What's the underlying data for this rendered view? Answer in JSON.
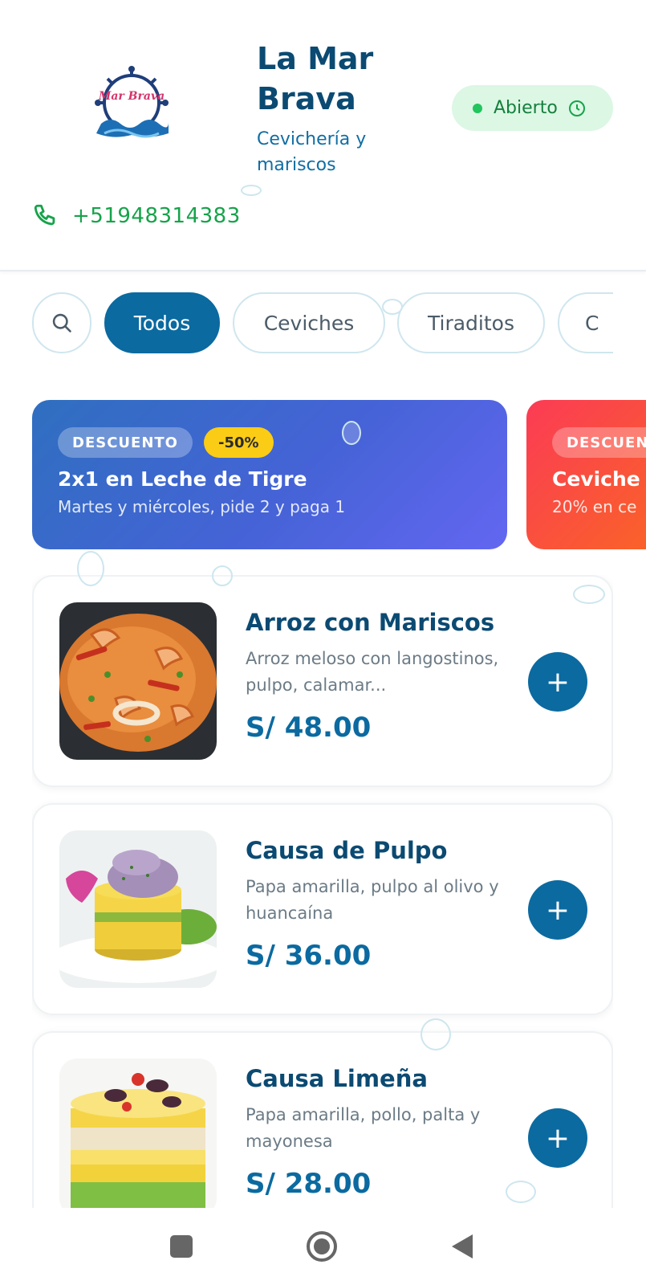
{
  "header": {
    "title": "La Mar Brava",
    "subtitle": "Cevichería y mariscos",
    "logo_text": "Mar Brava",
    "status": {
      "label": "Abierto",
      "color": "#22c55e"
    },
    "phone": "+51948314383"
  },
  "filters": {
    "search_icon": "search-icon",
    "categories": [
      "Todos",
      "Ceviches",
      "Tiraditos",
      "C"
    ],
    "active": "Todos"
  },
  "promos": [
    {
      "tag": "DESCUENTO",
      "badge": "-50%",
      "title": "2x1 en Leche de Tigre",
      "description": "Martes y miércoles, pide 2 y paga 1"
    },
    {
      "tag": "DESCUEN",
      "title": "Ceviche",
      "description": "20% en ce"
    }
  ],
  "dishes": [
    {
      "name": "Arroz con Mariscos",
      "description": "Arroz meloso con langostinos, pulpo, calamar...",
      "price": "S/ 48.00"
    },
    {
      "name": "Causa de Pulpo",
      "description": "Papa amarilla, pulpo al olivo y huancaína",
      "price": "S/ 36.00"
    },
    {
      "name": "Causa Limeña",
      "description": "Papa amarilla, pollo, palta y mayonesa",
      "price": "S/ 28.00"
    }
  ],
  "add_label": "+",
  "colors": {
    "primary": "#0b6aa0",
    "dark": "#0b4a72",
    "accent_green": "#16a34a"
  }
}
